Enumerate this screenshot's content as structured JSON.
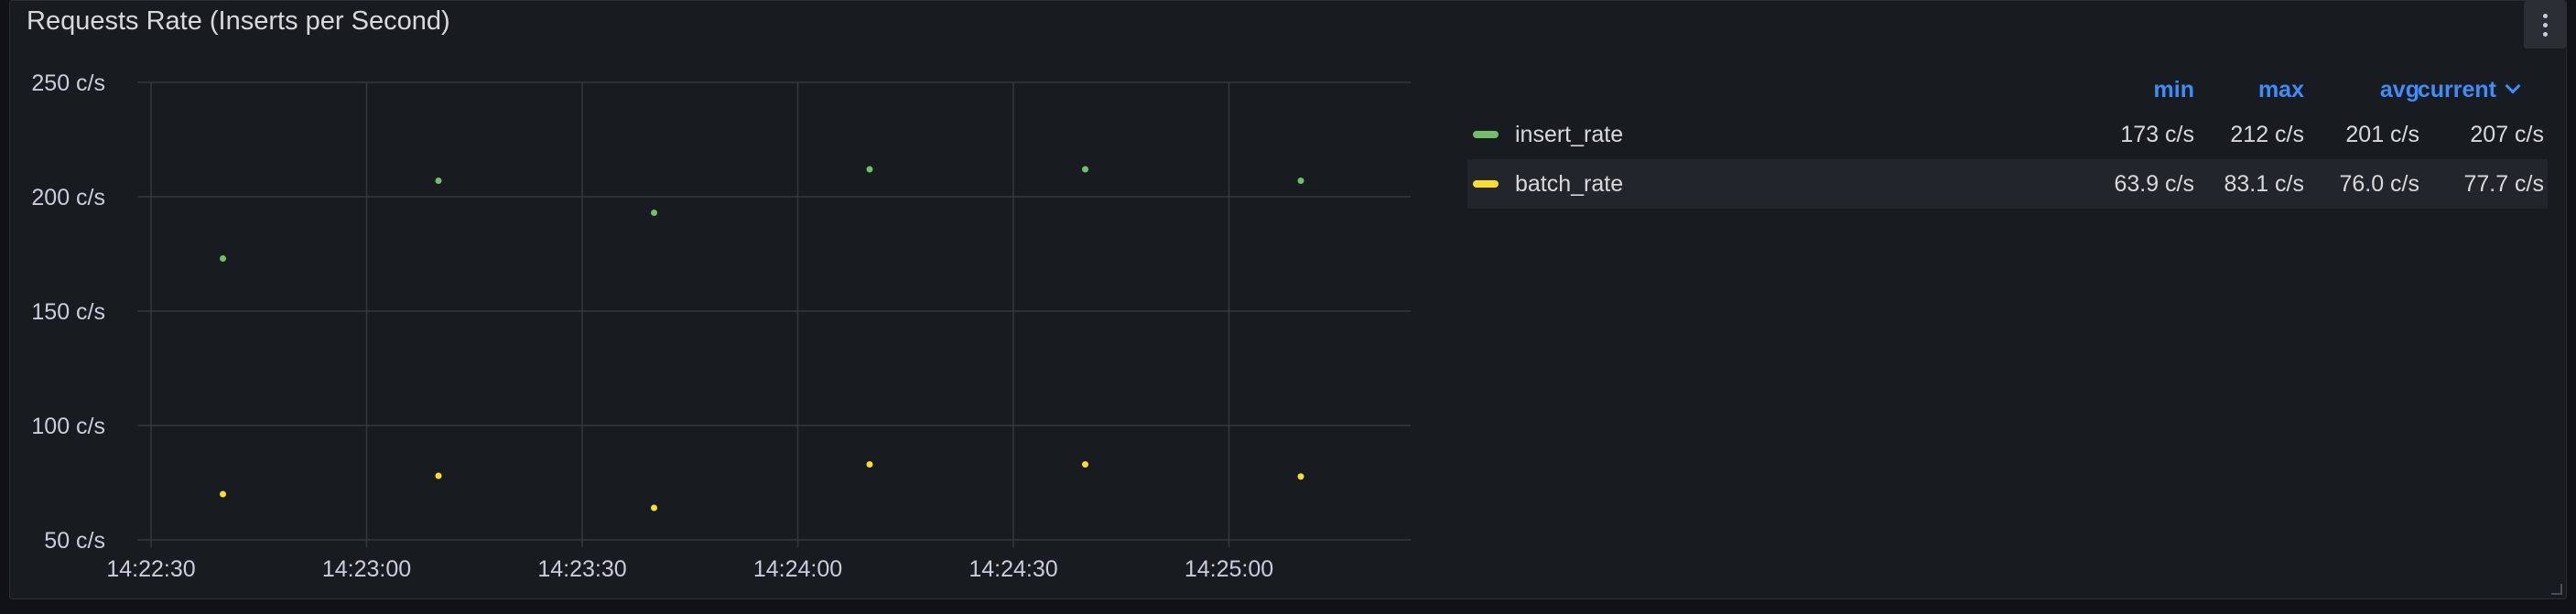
{
  "panel": {
    "title": "Requests Rate (Inserts per Second)"
  },
  "legend": {
    "headers": {
      "min": "min",
      "max": "max",
      "avg": "avg",
      "current": "current"
    },
    "rows": [
      {
        "name": "insert_rate",
        "color": "#73bf69",
        "min": "173 c/s",
        "max": "212 c/s",
        "avg": "201 c/s",
        "current": "207 c/s"
      },
      {
        "name": "batch_rate",
        "color": "#fade2a",
        "min": "63.9 c/s",
        "max": "83.1 c/s",
        "avg": "76.0 c/s",
        "current": "77.7 c/s"
      }
    ]
  },
  "chart_data": {
    "type": "scatter",
    "title": "Requests Rate (Inserts per Second)",
    "xlabel": "",
    "ylabel": "",
    "x_ticks": [
      "14:22:30",
      "14:23:00",
      "14:23:30",
      "14:24:00",
      "14:24:30",
      "14:25:00"
    ],
    "y_ticks": [
      "250 c/s",
      "200 c/s",
      "150 c/s",
      "100 c/s",
      "50 c/s"
    ],
    "ylim": [
      50,
      250
    ],
    "xlim": [
      "14:22:30",
      "14:25:25"
    ],
    "grid": true,
    "legend_position": "right",
    "x": [
      "14:22:40",
      "14:23:10",
      "14:23:40",
      "14:24:10",
      "14:24:40",
      "14:25:10"
    ],
    "series": [
      {
        "name": "insert_rate",
        "color": "#73bf69",
        "values": [
          173,
          207,
          193,
          212,
          212,
          207
        ]
      },
      {
        "name": "batch_rate",
        "color": "#fade2a",
        "values": [
          70,
          78,
          64,
          83,
          83,
          77.7
        ]
      }
    ]
  }
}
